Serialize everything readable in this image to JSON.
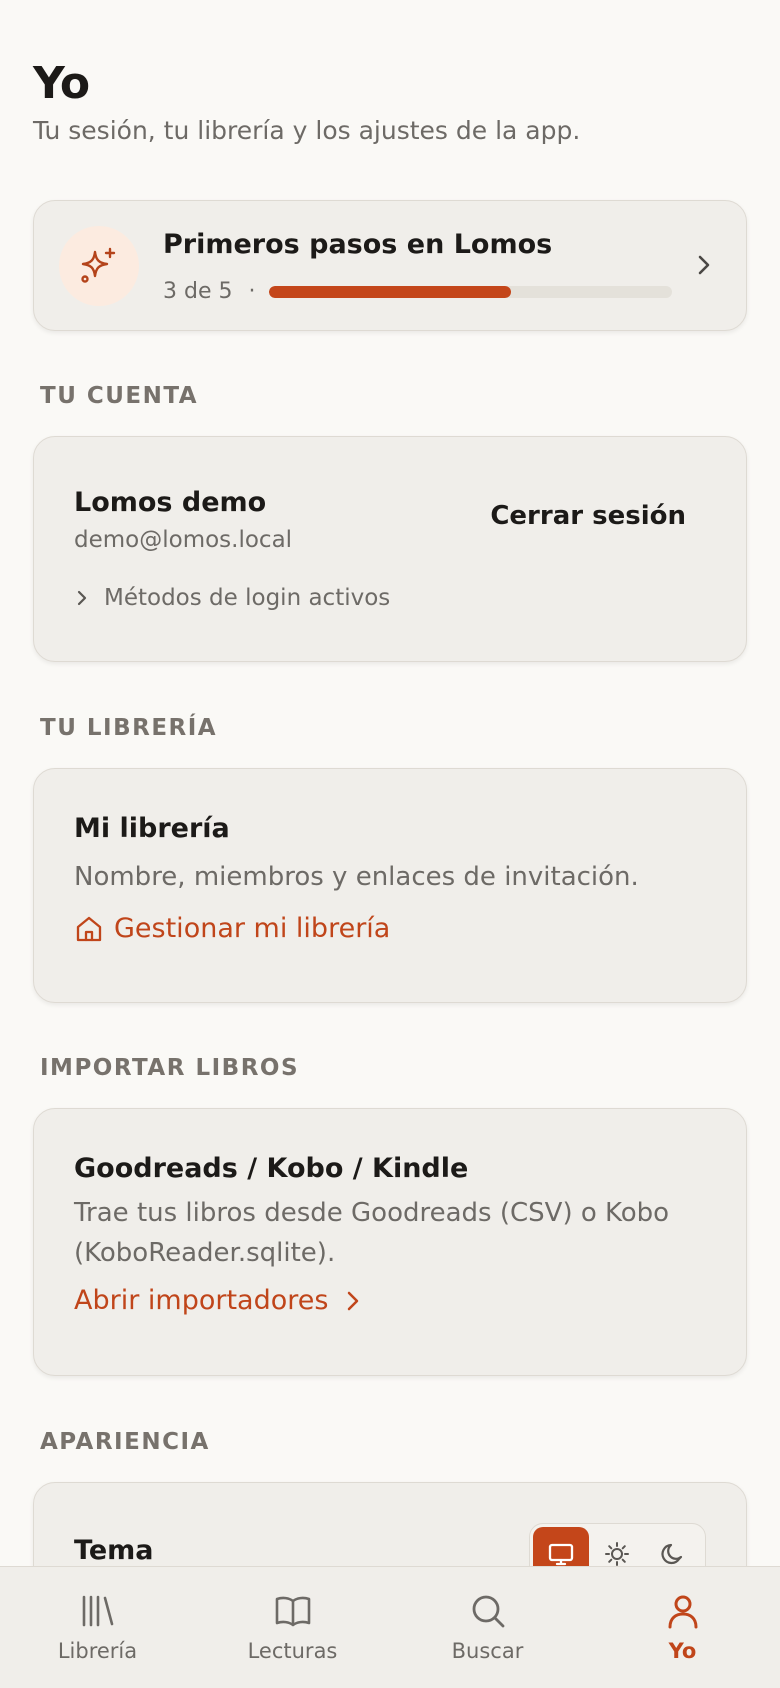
{
  "header": {
    "title": "Yo",
    "subtitle": "Tu sesión, tu librería y los ajustes de la app."
  },
  "onboarding": {
    "icon": "sparkles-icon",
    "title": "Primeros pasos en Lomos",
    "count_label": "3 de 5",
    "separator": "·",
    "progress": 0.6
  },
  "account": {
    "section_label": "TU CUENTA",
    "name": "Lomos demo",
    "email": "demo@lomos.local",
    "logout_label": "Cerrar sesión",
    "login_methods_label": "Métodos de login activos"
  },
  "library": {
    "section_label": "TU LIBRERÍA",
    "title": "Mi librería",
    "description": "Nombre, miembros y enlaces de invitación.",
    "link_label": "Gestionar mi librería"
  },
  "import": {
    "section_label": "IMPORTAR LIBROS",
    "title": "Goodreads / Kobo / Kindle",
    "description": "Trae tus libros desde Goodreads (CSV) o Kobo (KoboReader.sqlite).",
    "link_label": "Abrir importadores"
  },
  "appearance": {
    "section_label": "APARIENCIA",
    "theme_label": "Tema",
    "theme_options": [
      "system",
      "light",
      "dark"
    ],
    "theme_selected": "system"
  },
  "tabbar": {
    "items": [
      {
        "label": "Librería",
        "icon": "library-icon"
      },
      {
        "label": "Lecturas",
        "icon": "book-open-icon"
      },
      {
        "label": "Buscar",
        "icon": "search-icon"
      },
      {
        "label": "Yo",
        "icon": "user-icon"
      }
    ],
    "active": "Yo"
  },
  "colors": {
    "accent": "#c4461a",
    "background": "#faf9f6",
    "card": "#f0eeea",
    "muted_text": "#6d6a66"
  }
}
